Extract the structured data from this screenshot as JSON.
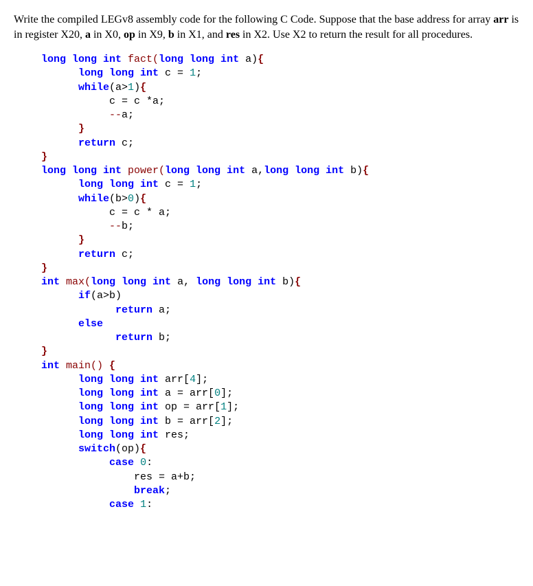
{
  "prompt": {
    "p1_a": "Write the compiled LEGv8 assembly code for the following C Code. Suppose that the base address for array ",
    "arr": "arr",
    "p1_b": " is in register X20, ",
    "a": "a",
    "p1_c": " in X0, ",
    "op": "op",
    "p1_d": " in X9, ",
    "b": "b",
    "p1_e": " in X1, and ",
    "res": "res",
    "p1_f": " in X2. Use X2 to return the result for all procedures."
  },
  "code": {
    "l1_a": "long long int",
    "l1_b": " fact(",
    "l1_c": "long long int",
    "l1_d": " a)",
    "l1_e": "{",
    "l2_a": "long long int",
    "l2_b": " c = ",
    "l2_c": "1",
    "l2_d": ";",
    "l3_a": "while",
    "l3_b": "(a>",
    "l3_c": "1",
    "l3_d": ")",
    "l3_e": "{",
    "l4": "c = c *a;",
    "l5_a": "--",
    "l5_b": "a;",
    "l6": "}",
    "l7_a": "return",
    "l7_b": " c;",
    "l8": "}",
    "l9_a": "long long int",
    "l9_b": " power(",
    "l9_c": "long long int",
    "l9_d": " a,",
    "l9_e": "long long int",
    "l9_f": " b)",
    "l9_g": "{",
    "l10_a": "long long int",
    "l10_b": " c = ",
    "l10_c": "1",
    "l10_d": ";",
    "l11_a": "while",
    "l11_b": "(b>",
    "l11_c": "0",
    "l11_d": ")",
    "l11_e": "{",
    "l12": "c = c * a;",
    "l13_a": "--",
    "l13_b": "b;",
    "l14": "}",
    "l15_a": "return",
    "l15_b": " c;",
    "l16": "}",
    "l17_a": "int",
    "l17_b": " max(",
    "l17_c": "long long int",
    "l17_d": " a, ",
    "l17_e": "long long int",
    "l17_f": " b)",
    "l17_g": "{",
    "l18_a": "if",
    "l18_b": "(a>b)",
    "l19_a": "return",
    "l19_b": " a;",
    "l20": "else",
    "l21_a": "return",
    "l21_b": " b;",
    "l22": "}",
    "l23_a": "int",
    "l23_b": " main() ",
    "l23_c": "{",
    "l24_a": "long long int",
    "l24_b": " arr[",
    "l24_c": "4",
    "l24_d": "];",
    "l25_a": "long long int",
    "l25_b": " a = arr[",
    "l25_c": "0",
    "l25_d": "];",
    "l26_a": "long long int",
    "l26_b": " op = arr[",
    "l26_c": "1",
    "l26_d": "];",
    "l27_a": "long long int",
    "l27_b": " b = arr[",
    "l27_c": "2",
    "l27_d": "];",
    "l28_a": "long long int",
    "l28_b": " res;",
    "l29_a": "switch",
    "l29_b": "(op)",
    "l29_c": "{",
    "l30_a": "case",
    "l30_b": " ",
    "l30_c": "0",
    "l30_d": ":",
    "l31": "res = a+b;",
    "l32_a": "break",
    "l32_b": ";",
    "l33_a": "case",
    "l33_b": " ",
    "l33_c": "1",
    "l33_d": ":"
  }
}
